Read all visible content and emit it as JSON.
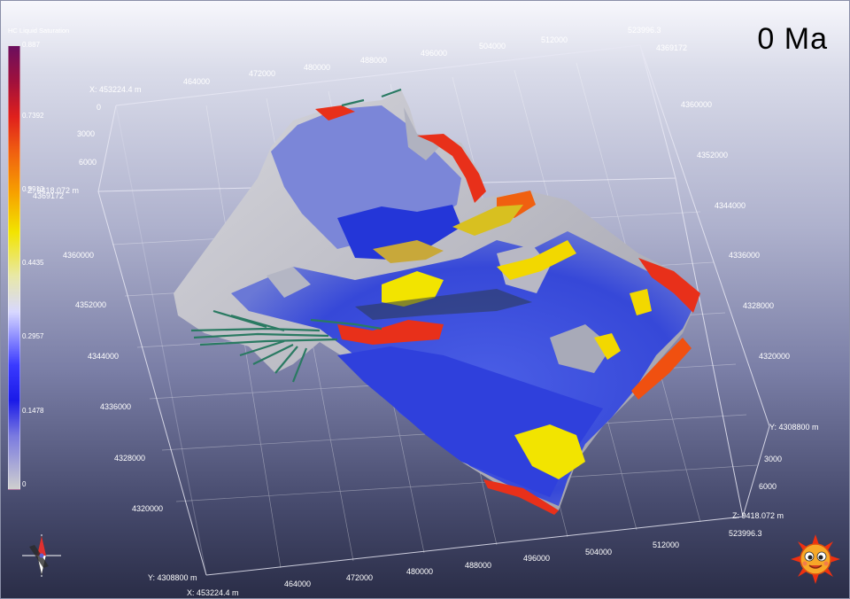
{
  "time_label": "0 Ma",
  "colorbar": {
    "title": "HC Liquid Saturation",
    "ticks": [
      "0.887",
      "0.7392",
      "0.5913",
      "0.4435",
      "0.2957",
      "0.1478",
      "0"
    ]
  },
  "axes": {
    "top_x_ticks": [
      "464000",
      "472000",
      "480000",
      "488000",
      "496000",
      "504000",
      "512000"
    ],
    "top_x_start": "X: 453224.4 m",
    "top_x_end": "523996.3",
    "right_y_top": "4369172",
    "right_y_ticks": [
      "4360000",
      "4352000",
      "4344000",
      "4336000",
      "4328000",
      "4320000"
    ],
    "left_y_ticks": [
      "4360000",
      "4352000",
      "4344000",
      "4336000",
      "4328000",
      "4320000"
    ],
    "left_y_start": "4369172",
    "left_z_ticks": [
      "0",
      "3000",
      "6000"
    ],
    "left_z_end": "Z: 9418.072 m",
    "right_z_ticks": [
      "3000",
      "6000"
    ],
    "right_y_bottom": "Y: 4308800 m",
    "right_z_end": "Z: 9418.072 m",
    "right_x_end": "523996.3",
    "bottom_x_ticks": [
      "464000",
      "472000",
      "480000",
      "488000",
      "496000",
      "504000",
      "512000"
    ],
    "bottom_y_start": "Y: 4308800 m",
    "bottom_x_start": "X: 453224.4 m"
  },
  "colors": {
    "high": "#e8301a",
    "mid": "#f2e400",
    "low": "#2a2ae8",
    "none": "#c8c8c8",
    "wells": "#2a7a62"
  },
  "icons": [
    "compass-icon",
    "sun-face-icon"
  ]
}
